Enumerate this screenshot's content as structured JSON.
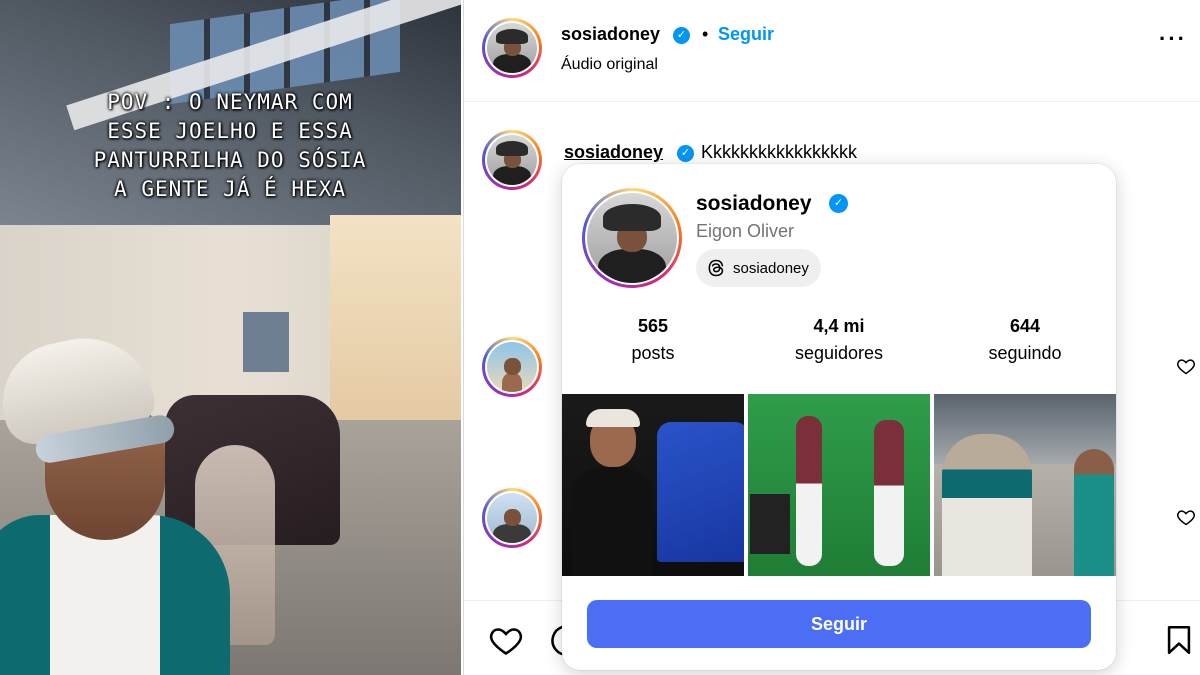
{
  "video": {
    "overlay_lines": [
      "POV : O NEYMAR COM",
      "ESSE JOELHO E ESSA",
      "PANTURRILHA DO SÓSIA",
      "A GENTE JÁ É HEXA"
    ]
  },
  "post_header": {
    "username": "sosiadoney",
    "separator": "•",
    "follow_label": "Seguir",
    "audio_label": "Áudio original",
    "more_icon": "more-options-icon"
  },
  "comment": {
    "username": "sosiadoney",
    "text": "Kkkkkkkkkkkkkkkkk"
  },
  "profile_card": {
    "username": "sosiadoney",
    "full_name": "Eigon Oliver",
    "threads_handle": "sosiadoney",
    "stats": [
      {
        "value": "565",
        "label": "posts"
      },
      {
        "value": "4,4 mi",
        "label": "seguidores"
      },
      {
        "value": "644",
        "label": "seguindo"
      }
    ],
    "follow_button": "Seguir"
  },
  "colors": {
    "verified": "#0095f6",
    "link_blue": "#0095f6",
    "follow_button": "#4c6ef5"
  }
}
